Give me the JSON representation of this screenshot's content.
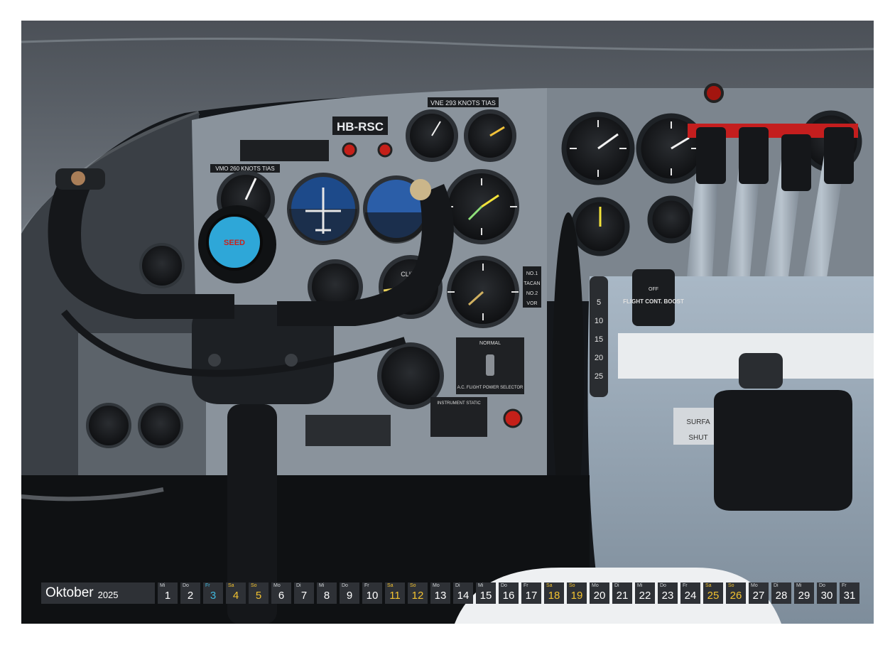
{
  "calendar": {
    "month": "Oktober",
    "year": "2025",
    "days": [
      {
        "wd": "Mi",
        "d": "1",
        "kind": "weekday"
      },
      {
        "wd": "Do",
        "d": "2",
        "kind": "weekday"
      },
      {
        "wd": "Fr",
        "d": "3",
        "kind": "holiday"
      },
      {
        "wd": "Sa",
        "d": "4",
        "kind": "sat"
      },
      {
        "wd": "So",
        "d": "5",
        "kind": "sun"
      },
      {
        "wd": "Mo",
        "d": "6",
        "kind": "weekday"
      },
      {
        "wd": "Di",
        "d": "7",
        "kind": "weekday"
      },
      {
        "wd": "Mi",
        "d": "8",
        "kind": "weekday"
      },
      {
        "wd": "Do",
        "d": "9",
        "kind": "weekday"
      },
      {
        "wd": "Fr",
        "d": "10",
        "kind": "weekday"
      },
      {
        "wd": "Sa",
        "d": "11",
        "kind": "sat"
      },
      {
        "wd": "So",
        "d": "12",
        "kind": "sun"
      },
      {
        "wd": "Mo",
        "d": "13",
        "kind": "weekday"
      },
      {
        "wd": "Di",
        "d": "14",
        "kind": "weekday"
      },
      {
        "wd": "Mi",
        "d": "15",
        "kind": "weekday"
      },
      {
        "wd": "Do",
        "d": "16",
        "kind": "weekday"
      },
      {
        "wd": "Fr",
        "d": "17",
        "kind": "weekday"
      },
      {
        "wd": "Sa",
        "d": "18",
        "kind": "sat"
      },
      {
        "wd": "So",
        "d": "19",
        "kind": "sun"
      },
      {
        "wd": "Mo",
        "d": "20",
        "kind": "weekday"
      },
      {
        "wd": "Di",
        "d": "21",
        "kind": "weekday"
      },
      {
        "wd": "Mi",
        "d": "22",
        "kind": "weekday"
      },
      {
        "wd": "Do",
        "d": "23",
        "kind": "weekday"
      },
      {
        "wd": "Fr",
        "d": "24",
        "kind": "weekday"
      },
      {
        "wd": "Sa",
        "d": "25",
        "kind": "sat"
      },
      {
        "wd": "So",
        "d": "26",
        "kind": "sun"
      },
      {
        "wd": "Mo",
        "d": "27",
        "kind": "weekday"
      },
      {
        "wd": "Di",
        "d": "28",
        "kind": "weekday"
      },
      {
        "wd": "Mi",
        "d": "29",
        "kind": "weekday"
      },
      {
        "wd": "Do",
        "d": "30",
        "kind": "weekday"
      },
      {
        "wd": "Fr",
        "d": "31",
        "kind": "weekday"
      }
    ]
  },
  "photo": {
    "registration": "HB-RSC",
    "vne_placard": "VNE 293 KNOTS TIAS",
    "vmo_placard": "VMO 260 KNOTS TIAS",
    "boost_label": "FLIGHT CONT. BOOST",
    "boost_off": "OFF",
    "climb_label": "CLIMB",
    "surface_label": "SURFA",
    "shut_label": "SHUT",
    "power_selector": "A.C. FLIGHT POWER SELECTOR",
    "normal_label": "NORMAL",
    "instrument_label": "INSTRUMENT STATIC",
    "nav_labels": [
      "NO.1",
      "TACAN",
      "NO.2",
      "VOR"
    ],
    "trim_scale": [
      "5",
      "10",
      "15",
      "20",
      "25"
    ],
    "yoke_emblem": "SEED",
    "colors": {
      "panel": "#8a939c",
      "glare_shield": "#7c858e",
      "pedestal": "#9aaab8",
      "yoke": "#15171a",
      "emblem": "#2ea7d8"
    }
  }
}
